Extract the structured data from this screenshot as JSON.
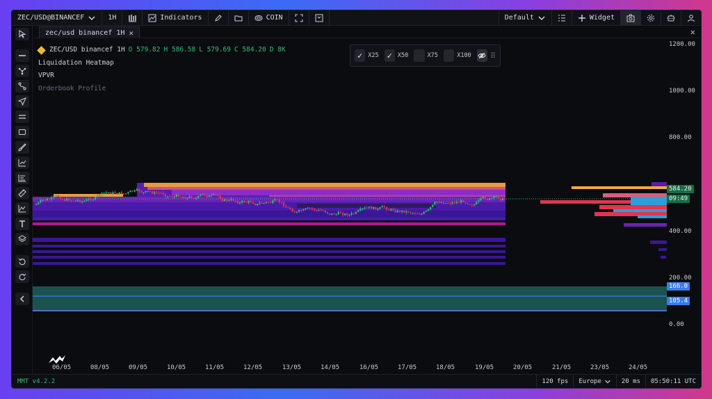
{
  "topbar": {
    "symbol": "ZEC/USD@BINANCEF",
    "timeframe": "1H",
    "indicators_label": "Indicators",
    "coin_label": "COIN",
    "layout_label": "Default",
    "widget_label": "Widget"
  },
  "tab": {
    "title": "zec/usd binancef 1H"
  },
  "legend": {
    "symbol_line": "ZEC/USD binancef 1H",
    "open": "O 579.82",
    "high": "H 586.58",
    "low": "L 579.69",
    "close": "C 584.20",
    "volume": "D 8K",
    "studies": [
      "Liquidation Heatmap",
      "VPVR",
      "Orderbook Profile"
    ]
  },
  "heatmap_controls": {
    "options": [
      {
        "label": "X25",
        "checked": true
      },
      {
        "label": "X50",
        "checked": true
      },
      {
        "label": "X75",
        "checked": false
      },
      {
        "label": "X100",
        "checked": false
      }
    ]
  },
  "price_axis": {
    "labels": [
      "1200.00",
      "1000.00",
      "800.00",
      "400.00",
      "200.00",
      "0.00"
    ],
    "current_price": "584.20",
    "countdown": "09:49",
    "line1": "166.0",
    "line2": "105.4"
  },
  "time_axis": {
    "labels": [
      "06/05",
      "08/05",
      "09/05",
      "10/05",
      "11/05",
      "12/05",
      "13/05",
      "14/05",
      "16/05",
      "17/05",
      "18/05",
      "19/05",
      "20/05",
      "21/05",
      "23/05",
      "24/05"
    ]
  },
  "statusbar": {
    "version": "MMT v4.2.2",
    "fps": "120 fps",
    "region": "Europe",
    "latency": "20 ms",
    "time": "05:50:11 UTC"
  },
  "colors": {
    "up": "#2fbf71",
    "down": "#e0364f",
    "accent_blue": "#3b7de8",
    "heat_purple": "#6a1fb8",
    "heat_orange": "#f5a93a"
  }
}
